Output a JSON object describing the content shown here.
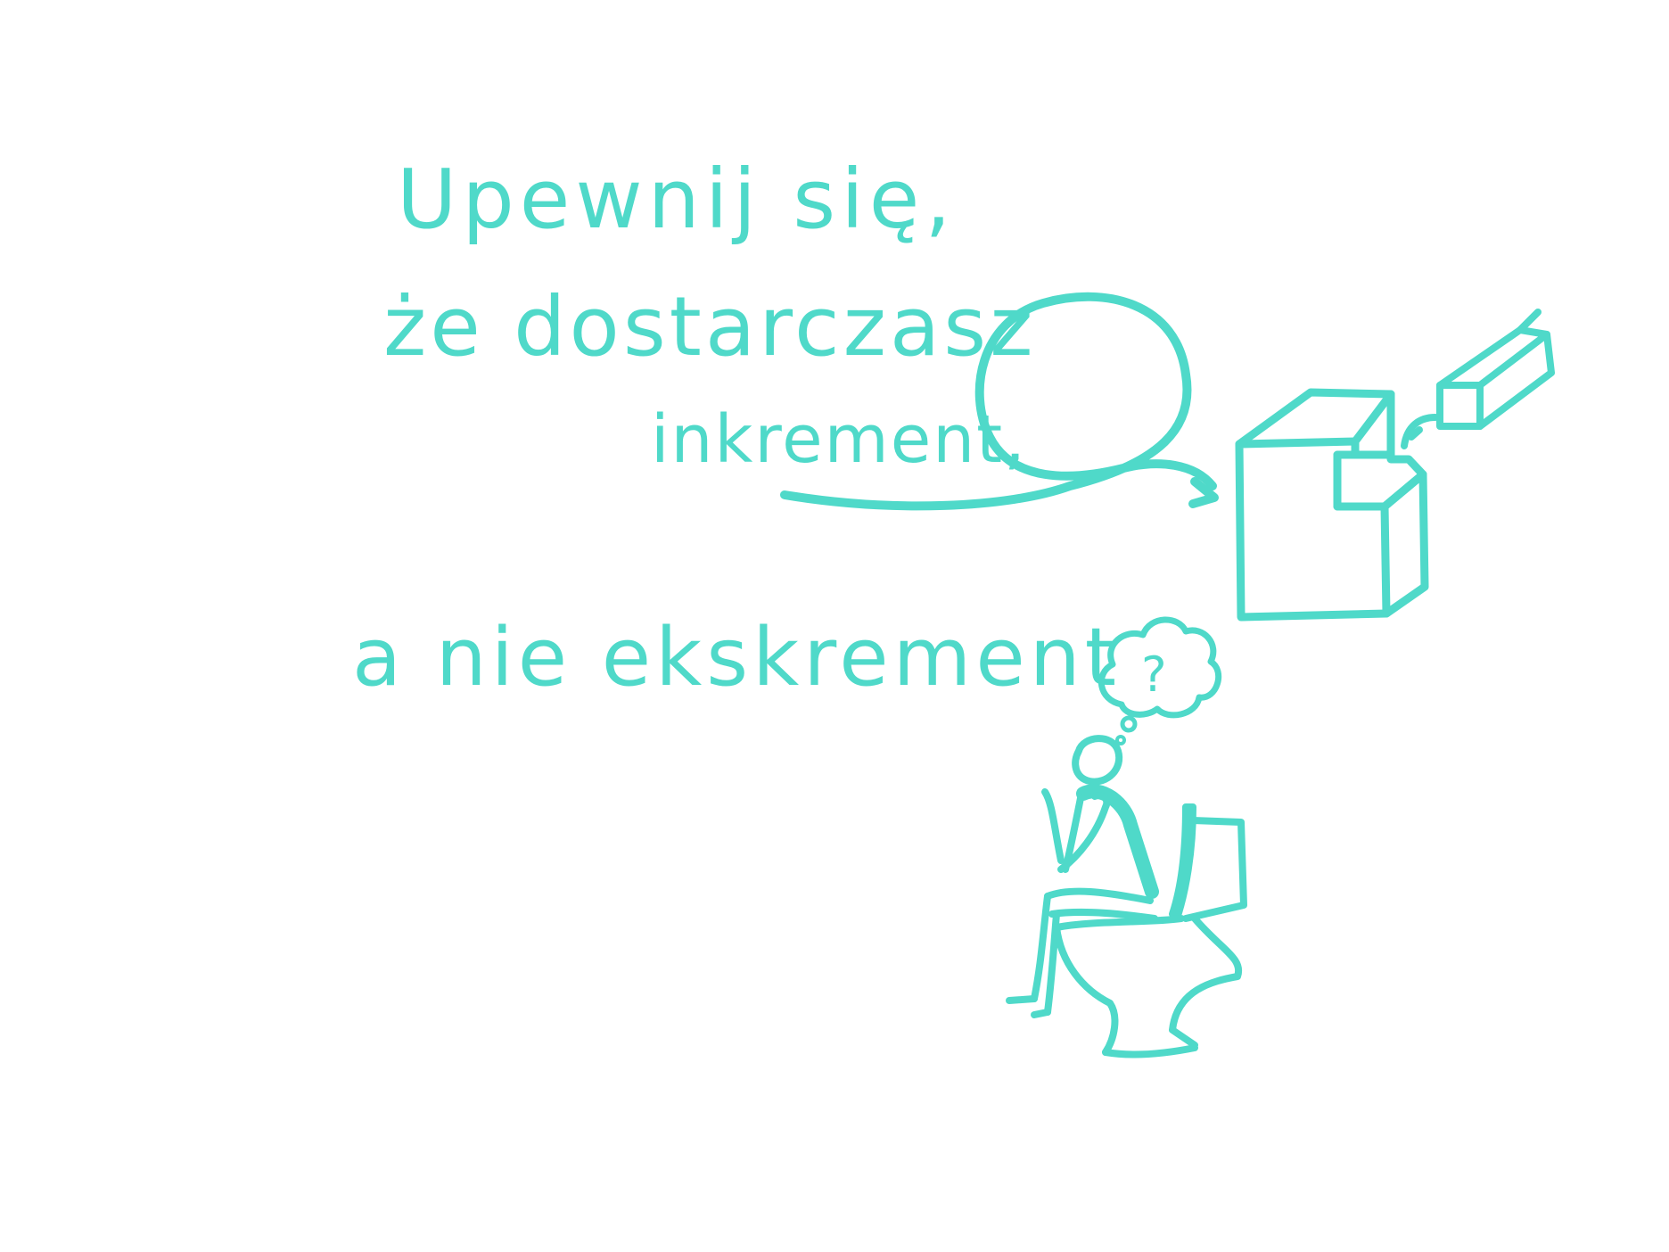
{
  "sketch": {
    "line1": "Upewnij się,",
    "line2": "że dostarczasz",
    "line3": "inkrement,",
    "line4": "a nie ekskrement",
    "thought_mark": "?"
  },
  "colors": {
    "ink": "#4fd9c9",
    "background": "#ffffff"
  },
  "icons": [
    "loop-arrow-icon",
    "cube-icon",
    "puzzle-piece-icon",
    "thought-bubble-icon",
    "person-on-toilet-icon"
  ]
}
